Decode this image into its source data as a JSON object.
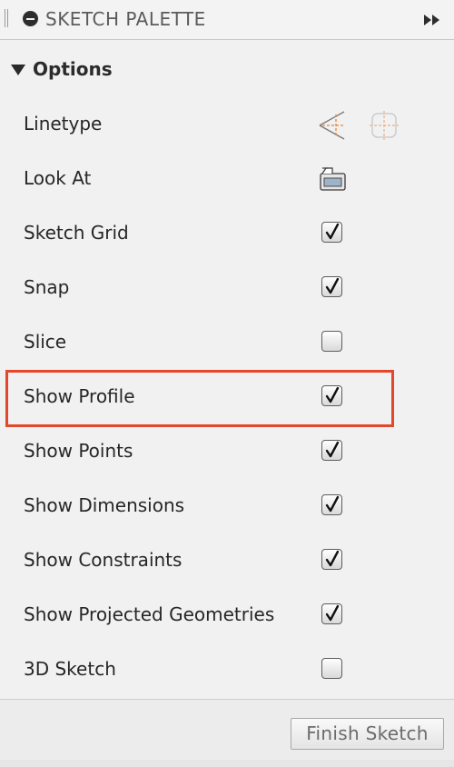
{
  "header": {
    "title": "SKETCH PALETTE",
    "icon": "minus-circle-icon",
    "expand_icon": "double-chevron-right-icon"
  },
  "section": {
    "title": "Options",
    "expanded": true
  },
  "rows": [
    {
      "label": "Linetype",
      "control": "icons",
      "icons": [
        "construction-line-icon",
        "centerline-icon"
      ]
    },
    {
      "label": "Look At",
      "control": "icon",
      "icons": [
        "look-at-icon"
      ]
    },
    {
      "label": "Sketch Grid",
      "control": "checkbox",
      "checked": true
    },
    {
      "label": "Snap",
      "control": "checkbox",
      "checked": true
    },
    {
      "label": "Slice",
      "control": "checkbox",
      "checked": false
    },
    {
      "label": "Show Profile",
      "control": "checkbox",
      "checked": true,
      "highlighted": true
    },
    {
      "label": "Show Points",
      "control": "checkbox",
      "checked": true
    },
    {
      "label": "Show Dimensions",
      "control": "checkbox",
      "checked": true
    },
    {
      "label": "Show Constraints",
      "control": "checkbox",
      "checked": true
    },
    {
      "label": "Show Projected Geometries",
      "control": "checkbox",
      "checked": true
    },
    {
      "label": "3D Sketch",
      "control": "checkbox",
      "checked": false
    }
  ],
  "footer": {
    "finish_label": "Finish Sketch"
  },
  "colors": {
    "highlight": "#e4472b",
    "construction_orange": "#e8823a",
    "panel_bg": "#f1f1f1"
  }
}
